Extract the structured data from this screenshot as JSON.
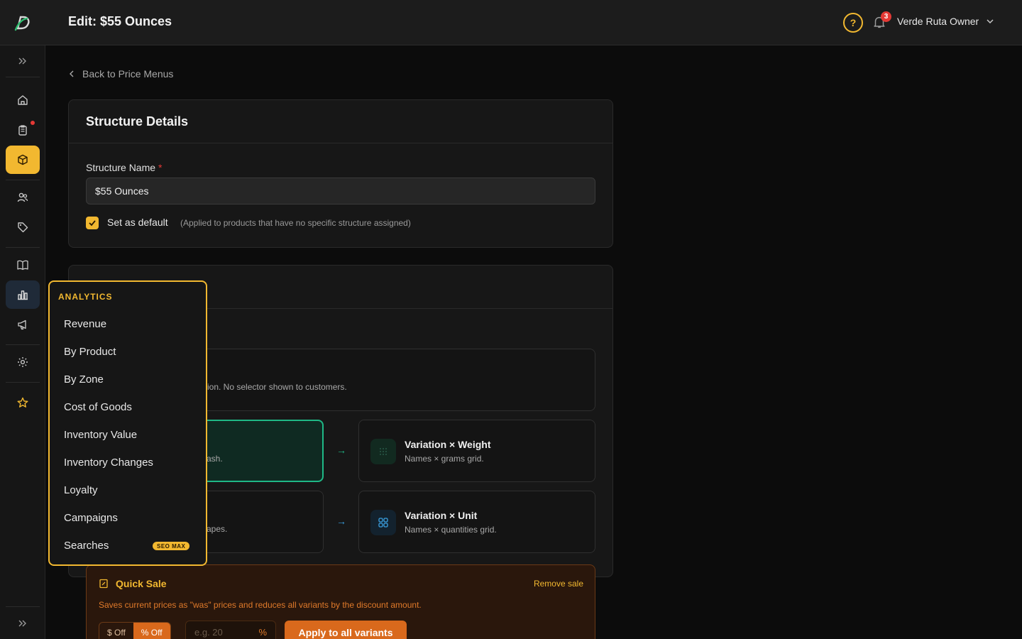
{
  "header": {
    "title": "Edit: $55 Ounces",
    "help_icon": "question-circle-icon",
    "notification_count": "3",
    "user_name": "Verde Ruta Owner"
  },
  "sidebar": {
    "items": [
      {
        "name": "home",
        "icon": "home-icon"
      },
      {
        "name": "orders",
        "icon": "clipboard-icon"
      },
      {
        "name": "products",
        "icon": "box-icon"
      },
      {
        "name": "customers",
        "icon": "users-icon"
      },
      {
        "name": "pricing",
        "icon": "tag-icon"
      },
      {
        "name": "catalog",
        "icon": "book-icon"
      },
      {
        "name": "analytics",
        "icon": "bar-chart-icon"
      },
      {
        "name": "marketing",
        "icon": "megaphone-icon"
      },
      {
        "name": "settings",
        "icon": "gear-icon"
      },
      {
        "name": "favorites",
        "icon": "star-icon"
      }
    ],
    "accent": "#f2b830"
  },
  "back_link": "Back to Price Menus",
  "structure": {
    "title": "Structure Details",
    "name_label": "Structure Name",
    "required_mark": "*",
    "name_value": "$55 Ounces",
    "default_label": "Set as default",
    "default_hint": "(Applied to products that have no specific structure assigned)",
    "default_checked": true
  },
  "options": {
    "simple_desc_partial": "ion. No selector shown to customers.",
    "weight_desc_partial": "ash.",
    "unit_desc_partial": "apes.",
    "variation_weight": {
      "title": "Variation × Weight",
      "desc": "Names × grams grid."
    },
    "variation_unit": {
      "title": "Variation × Unit",
      "desc": "Names × quantities grid."
    },
    "arrow": "→"
  },
  "quick_sale": {
    "title": "Quick Sale",
    "remove": "Remove sale",
    "description": "Saves current prices as \"was\" prices and reduces all variants by the discount amount.",
    "dollar_off": "$ Off",
    "percent_off": "% Off",
    "placeholder": "e.g. 20",
    "unit": "%",
    "apply": "Apply to all variants"
  },
  "analytics_menu": {
    "title": "ANALYTICS",
    "items": [
      "Revenue",
      "By Product",
      "By Zone",
      "Cost of Goods",
      "Inventory Value",
      "Inventory Changes",
      "Loyalty",
      "Campaigns",
      "Searches"
    ],
    "badge": "SEO MAX"
  }
}
